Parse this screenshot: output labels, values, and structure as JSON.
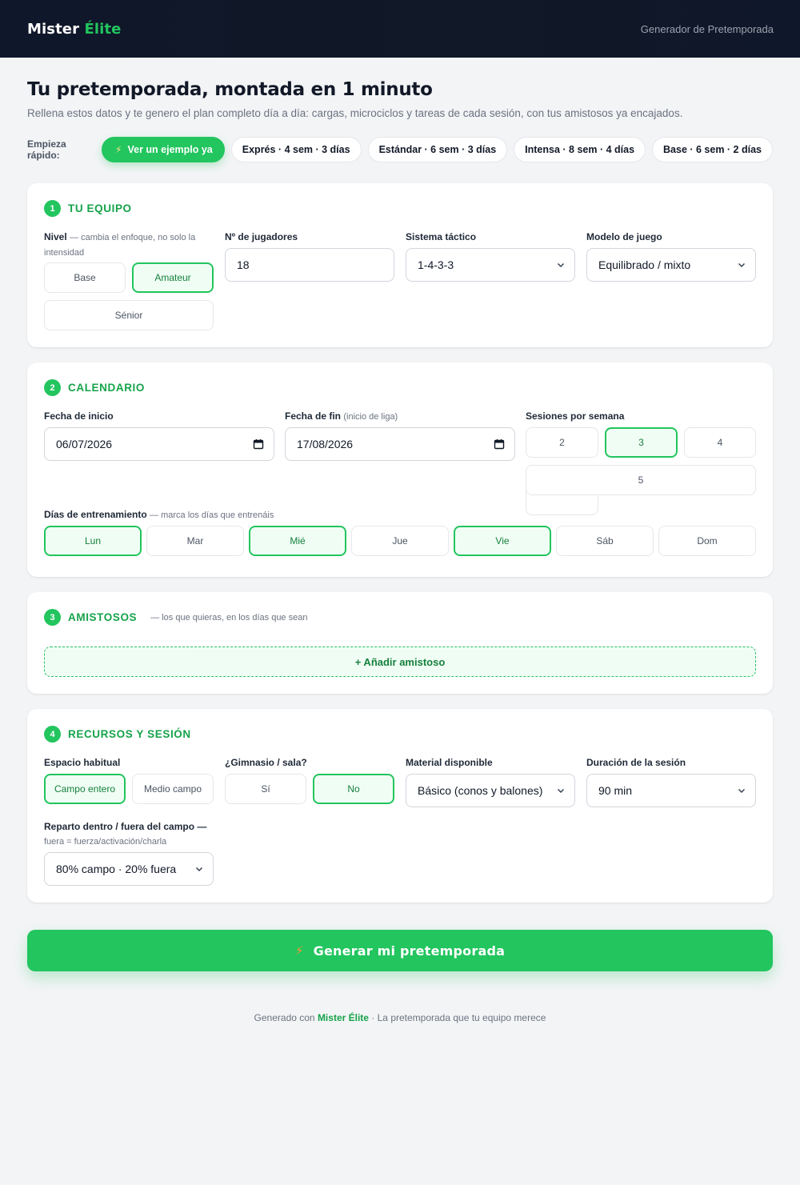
{
  "header": {
    "brand_main": "Mister ",
    "brand_accent": "Élite",
    "nav_label": "Generador de Pretemporada"
  },
  "hero": {
    "title": "Tu pretemporada, montada en 1 minuto",
    "subtitle": "Rellena estos datos y te genero el plan completo día a día: cargas, microciclos y tareas de cada sesión, con tus amistosos ya encajados."
  },
  "quick_start": {
    "label": "Empieza rápido:",
    "chips": [
      "Ver un ejemplo ya",
      "Exprés · 4 sem · 3 días",
      "Estándar · 6 sem · 3 días",
      "Intensa · 8 sem · 4 días",
      "Base · 6 sem · 2 días"
    ]
  },
  "equipo": {
    "num": "1",
    "title": "TU EQUIPO",
    "nivel_label": "Nivel",
    "nivel_hint": "— cambia el enfoque, no solo la intensidad",
    "nivel_options": [
      "Base",
      "Amateur",
      "Sénior"
    ],
    "nivel_selected": "Amateur",
    "jugadores_label": "Nº de jugadores",
    "jugadores_value": "18",
    "sistema_label": "Sistema táctico",
    "sistema_value": "1-4-3-3",
    "modelo_label": "Modelo de juego",
    "modelo_value": "Equilibrado / mixto"
  },
  "calendario": {
    "num": "2",
    "title": "CALENDARIO",
    "inicio_label": "Fecha de inicio",
    "inicio_value": "06/07/2026",
    "fin_label": "Fecha de fin",
    "fin_hint": "(inicio de liga)",
    "fin_value": "17/08/2026",
    "sesiones_label": "Sesiones por semana",
    "sesiones_options": [
      "2",
      "3",
      "4",
      "5"
    ],
    "sesiones_selected": "3",
    "dias_label": "Días de entrenamiento",
    "dias_hint": "— marca los días que entrenáis",
    "dias": [
      "Lun",
      "Mar",
      "Mié",
      "Jue",
      "Vie",
      "Sáb",
      "Dom"
    ],
    "dias_selected": [
      "Lun",
      "Mié",
      "Vie"
    ]
  },
  "amistosos": {
    "num": "3",
    "title": "AMISTOSOS",
    "note": "— los que quieras, en los días que sean",
    "add_label": "+ Añadir amistoso"
  },
  "recursos": {
    "num": "4",
    "title": "RECURSOS Y SESIÓN",
    "espacio_label": "Espacio habitual",
    "espacio_options": [
      "Campo entero",
      "Medio campo"
    ],
    "espacio_selected": "Campo entero",
    "gimnasio_label": "¿Gimnasio / sala?",
    "gimnasio_options": [
      "Sí",
      "No"
    ],
    "gimnasio_selected": "No",
    "material_label": "Material disponible",
    "material_value": "Básico (conos y balones)",
    "duracion_label": "Duración de la sesión",
    "duracion_value": "90 min",
    "reparto_label": "Reparto dentro / fuera del campo —",
    "reparto_hint": "fuera = fuerza/activación/charla",
    "reparto_value": "80% campo · 20% fuera"
  },
  "cta": {
    "label": "Generar mi pretemporada"
  },
  "footer": {
    "prefix": "Generado con ",
    "brand": "Mister Élite",
    "suffix": " · La pretemporada que tu equipo merece"
  },
  "colors": {
    "accent": "#22c55e",
    "accent_dark": "#16a34a",
    "header_bg": "#0f172a",
    "page_bg": "#f3f4f6"
  },
  "icons": {
    "bolt": "lightning-icon",
    "select": "chevron-down-icon",
    "date": "calendar-icon"
  }
}
